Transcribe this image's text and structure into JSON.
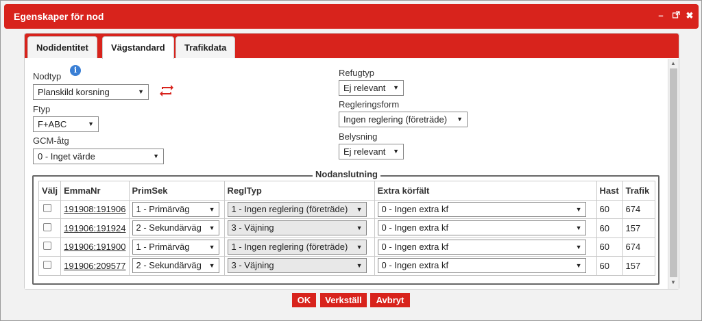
{
  "window": {
    "title": "Egenskaper för nod",
    "controls": {
      "minimize": "–",
      "popout": "⇗",
      "close": "✖"
    }
  },
  "tabs": [
    {
      "label": "Nodidentitet",
      "active": false
    },
    {
      "label": "Vägstandard",
      "active": true
    },
    {
      "label": "Trafikdata",
      "active": false
    }
  ],
  "form": {
    "nodtyp": {
      "label": "Nodtyp",
      "value": "Planskild korsning"
    },
    "ftyp": {
      "label": "Ftyp",
      "value": "F+ABC"
    },
    "gcm": {
      "label": "GCM-åtg",
      "value": "0 - Inget värde"
    },
    "refugtyp": {
      "label": "Refugtyp",
      "value": "Ej relevant"
    },
    "regleringsform": {
      "label": "Regleringsform",
      "value": "Ingen reglering (företräde)"
    },
    "belysning": {
      "label": "Belysning",
      "value": "Ej relevant"
    },
    "info_icon": "info-icon",
    "swap_icon": "swap-icon"
  },
  "nodanslutning": {
    "legend": "Nodanslutning",
    "columns": [
      "Välj",
      "EmmaNr",
      "PrimSek",
      "ReglTyp",
      "Extra körfält",
      "Hast",
      "Trafik"
    ],
    "rows": [
      {
        "emmanr": "191908:191906",
        "primsek": "1 - Primärväg",
        "regltyp": "1 - Ingen reglering (företräde)",
        "extra": "0 - Ingen extra kf",
        "hast": "60",
        "trafik": "674",
        "regl_gray": true
      },
      {
        "emmanr": "191906:191924",
        "primsek": "2 - Sekundärväg",
        "regltyp": "3 - Väjning",
        "extra": "0 - Ingen extra kf",
        "hast": "60",
        "trafik": "157",
        "regl_gray": true
      },
      {
        "emmanr": "191906:191900",
        "primsek": "1 - Primärväg",
        "regltyp": "1 - Ingen reglering (företräde)",
        "extra": "0 - Ingen extra kf",
        "hast": "60",
        "trafik": "674",
        "regl_gray": true
      },
      {
        "emmanr": "191906:209577",
        "primsek": "2 - Sekundärväg",
        "regltyp": "3 - Väjning",
        "extra": "0 - Ingen extra kf",
        "hast": "60",
        "trafik": "157",
        "regl_gray": true
      }
    ]
  },
  "buttons": {
    "ok": "OK",
    "apply": "Verkställ",
    "cancel": "Avbryt"
  },
  "colors": {
    "accent": "#d8231c",
    "info": "#3a7fd5"
  }
}
